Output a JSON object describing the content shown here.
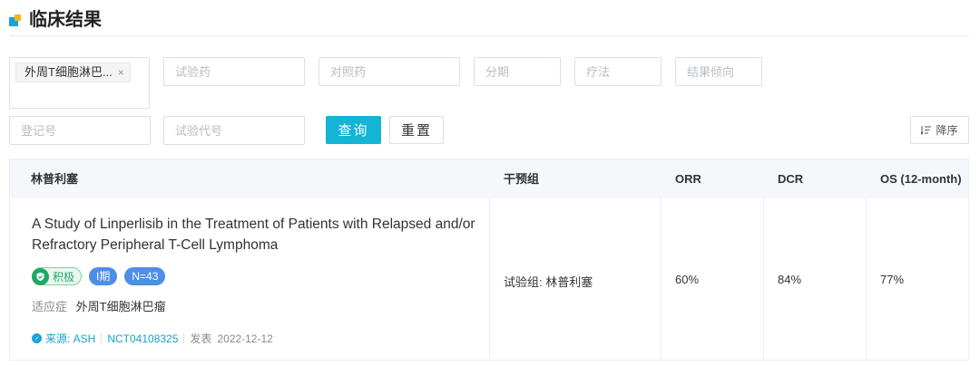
{
  "section": {
    "title": "临床结果",
    "title_icon": "section-title-icon"
  },
  "filters": {
    "disease_chip": "外周T细胞淋巴...",
    "disease_chip_close": "×",
    "drug_placeholder": "试验药",
    "comparator_placeholder": "对照药",
    "stage_placeholder": "分期",
    "therapy_placeholder": "疗法",
    "trend_placeholder": "结果倾向",
    "registration_placeholder": "登记号",
    "trial_code_placeholder": "试验代号",
    "query_label": "查询",
    "reset_label": "重置",
    "sort_label": "降序",
    "sort_icon": "sort-descending-icon"
  },
  "table": {
    "headers": [
      "林普利塞",
      "干预组",
      "ORR",
      "DCR",
      "OS (12-month)"
    ],
    "rows": [
      {
        "title": "A Study of Linperlisib in the Treatment of Patients with Relapsed and/or Refractory Peripheral T-Cell Lymphoma",
        "tag_positive": "积极",
        "tag_phase": "I期",
        "tag_n": "N=43",
        "indication_label": "适应症",
        "indication": "外周T细胞淋巴瘤",
        "source": "来源: ASH",
        "nct": "NCT04108325",
        "published_label": "发表",
        "published_date": "2022-12-12",
        "intervention": "试验组: 林普利塞",
        "orr": "60%",
        "dcr": "84%",
        "os12": "77%"
      }
    ]
  },
  "colors": {
    "accent": "#13b4d4",
    "positive": "#1ea864",
    "tag_blue": "#4d8ee6",
    "link": "#1a9fd0"
  }
}
